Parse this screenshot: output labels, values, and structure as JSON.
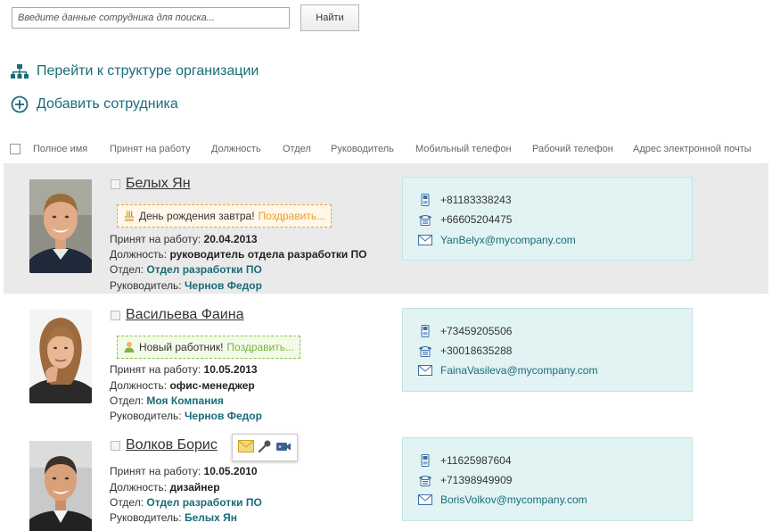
{
  "search": {
    "placeholder": "Введите данные сотрудника для поиска...",
    "value": "",
    "button_label": "Найти"
  },
  "nav": {
    "structure_label": "Перейти к структуре организации",
    "add_label": "Добавить сотрудника"
  },
  "columns": [
    "Полное имя",
    "Принят на работу",
    "Должность",
    "Отдел",
    "Руководитель",
    "Мобильный телефон",
    "Рабочий телефон",
    "Адрес электронной почты"
  ],
  "labels": {
    "hired": "Принят на работу:",
    "position": "Должность:",
    "department": "Отдел:",
    "manager": "Руководитель:"
  },
  "employees": [
    {
      "name": "Белых Ян",
      "badge": {
        "type": "birthday",
        "text": "День рождения завтра!",
        "action": "Поздравить..."
      },
      "hired": "20.04.2013",
      "position": "руководитель отдела разработки ПО",
      "department": "Отдел разработки ПО",
      "manager": "Чернов Федор",
      "mobile": "+81183338243",
      "work_phone": "+66605204475",
      "email": "YanBelyx@mycompany.com",
      "highlighted": true
    },
    {
      "name": "Васильева Фаина",
      "badge": {
        "type": "new",
        "text": "Новый работник!",
        "action": "Поздравить..."
      },
      "hired": "10.05.2013",
      "position": "офис-менеджер",
      "department": "Моя Компания",
      "manager": "Чернов Федор",
      "mobile": "+73459205506",
      "work_phone": "+30018635288",
      "email": "FainaVasileva@mycompany.com",
      "highlighted": false
    },
    {
      "name": "Волков Борис",
      "actions": [
        "mail-icon",
        "microphone-icon",
        "video-call-icon"
      ],
      "hired": "10.05.2010",
      "position": "дизайнер",
      "department": "Отдел разработки ПО",
      "manager": "Белых Ян",
      "mobile": "+11625987604",
      "work_phone": "+71398949909",
      "email": "BorisVolkov@mycompany.com",
      "highlighted": false
    }
  ],
  "colors": {
    "link": "#1a6c7a",
    "contact_bg": "#e1f3f3",
    "row_highlight": "#eaeaea",
    "birthday": "#e8a02a",
    "new_employee": "#7cb342"
  }
}
